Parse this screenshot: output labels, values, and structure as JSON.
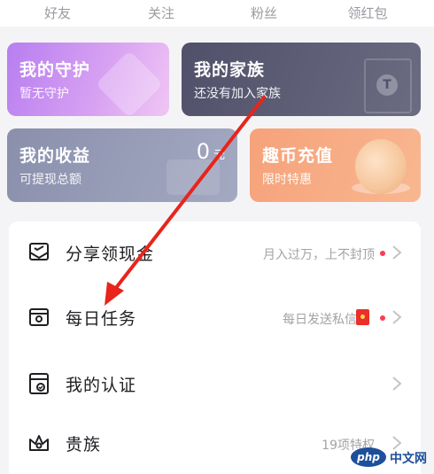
{
  "tabs": [
    "好友",
    "关注",
    "粉丝",
    "领红包"
  ],
  "cards": {
    "guard": {
      "title": "我的守护",
      "subtitle": "暂无守护"
    },
    "family": {
      "title": "我的家族",
      "subtitle": "还没有加入家族",
      "badge": "T"
    },
    "income": {
      "title": "我的收益",
      "subtitle": "可提现总额",
      "amount": "0",
      "unit": "元"
    },
    "recharge": {
      "title": "趣币充值",
      "subtitle": "限时特惠"
    }
  },
  "menu": [
    {
      "label": "分享领现金",
      "aux": "月入过万，上不封顶",
      "icon": "share-envelope-icon"
    },
    {
      "label": "每日任务",
      "aux": "每日发送私信",
      "icon": "task-envelope-icon"
    },
    {
      "label": "我的认证",
      "aux": "",
      "icon": "certificate-icon"
    },
    {
      "label": "贵族",
      "aux": "19项特权",
      "icon": "crown-icon"
    }
  ],
  "watermark": {
    "logo": "php",
    "text": "中文网"
  },
  "colors": {
    "accent_red": "#ff3b4e",
    "annotation_arrow": "#e8241c"
  }
}
